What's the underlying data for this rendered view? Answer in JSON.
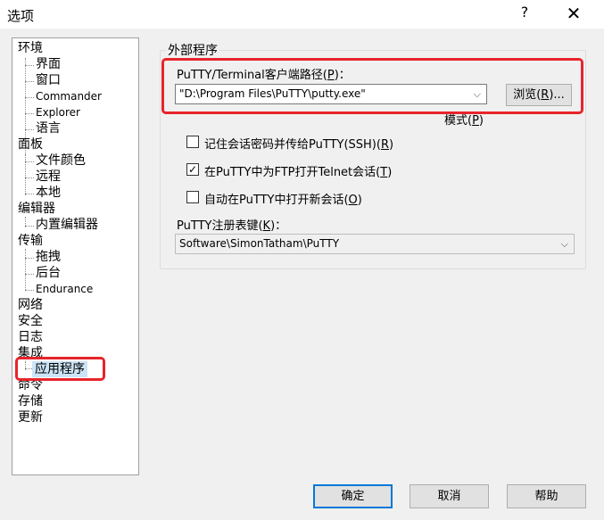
{
  "window": {
    "title": "选项",
    "help_glyph": "?",
    "close_glyph": "✕"
  },
  "tree": {
    "items": [
      {
        "label": "环境",
        "level": 0
      },
      {
        "label": "界面",
        "level": 1
      },
      {
        "label": "窗口",
        "level": 1
      },
      {
        "label": "Commander",
        "level": 1
      },
      {
        "label": "Explorer",
        "level": 1
      },
      {
        "label": "语言",
        "level": 1
      },
      {
        "label": "面板",
        "level": 0
      },
      {
        "label": "文件颜色",
        "level": 1
      },
      {
        "label": "远程",
        "level": 1
      },
      {
        "label": "本地",
        "level": 1
      },
      {
        "label": "编辑器",
        "level": 0
      },
      {
        "label": "内置编辑器",
        "level": 1
      },
      {
        "label": "传输",
        "level": 0
      },
      {
        "label": "拖拽",
        "level": 1
      },
      {
        "label": "后台",
        "level": 1
      },
      {
        "label": "Endurance",
        "level": 1
      },
      {
        "label": "网络",
        "level": 0
      },
      {
        "label": "安全",
        "level": 0
      },
      {
        "label": "日志",
        "level": 0
      },
      {
        "label": "集成",
        "level": 0
      },
      {
        "label": "应用程序",
        "level": 1,
        "selected": true
      },
      {
        "label": "命令",
        "level": 0
      },
      {
        "label": "存储",
        "level": 0
      },
      {
        "label": "更新",
        "level": 0
      }
    ]
  },
  "external_programs": {
    "group_title": "外部程序",
    "putty_path_label": "PuTTY/Terminal客户端路径(",
    "putty_path_key": "P",
    "putty_path_label_end": ")：",
    "putty_path_value": "\"D:\\Program Files\\PuTTY\\putty.exe\"",
    "browse_label": "浏览(",
    "browse_key": "R",
    "browse_label_end": ")...",
    "patterns_label": "模式(",
    "patterns_key": "P",
    "patterns_label_end": ")",
    "checkboxes": [
      {
        "label": "记住会话密码并传给PuTTY(SSH)(",
        "key": "R",
        "end": ")",
        "checked": false
      },
      {
        "label": "在PuTTY中为FTP打开Telnet会话(",
        "key": "T",
        "end": ")",
        "checked": true
      },
      {
        "label": "自动在PuTTY中打开新会话(",
        "key": "O",
        "end": ")",
        "checked": false
      }
    ],
    "registry_label": "PuTTY注册表键(",
    "registry_key": "K",
    "registry_label_end": ")：",
    "registry_value": "Software\\SimonTatham\\PuTTY"
  },
  "footer": {
    "ok_label": "确定",
    "cancel_label": "取消",
    "help_label": "帮助"
  },
  "accent": {
    "highlight_red": "#e8242b",
    "selection_bg": "#cce4f7",
    "default_button_border": "#0078d7"
  }
}
